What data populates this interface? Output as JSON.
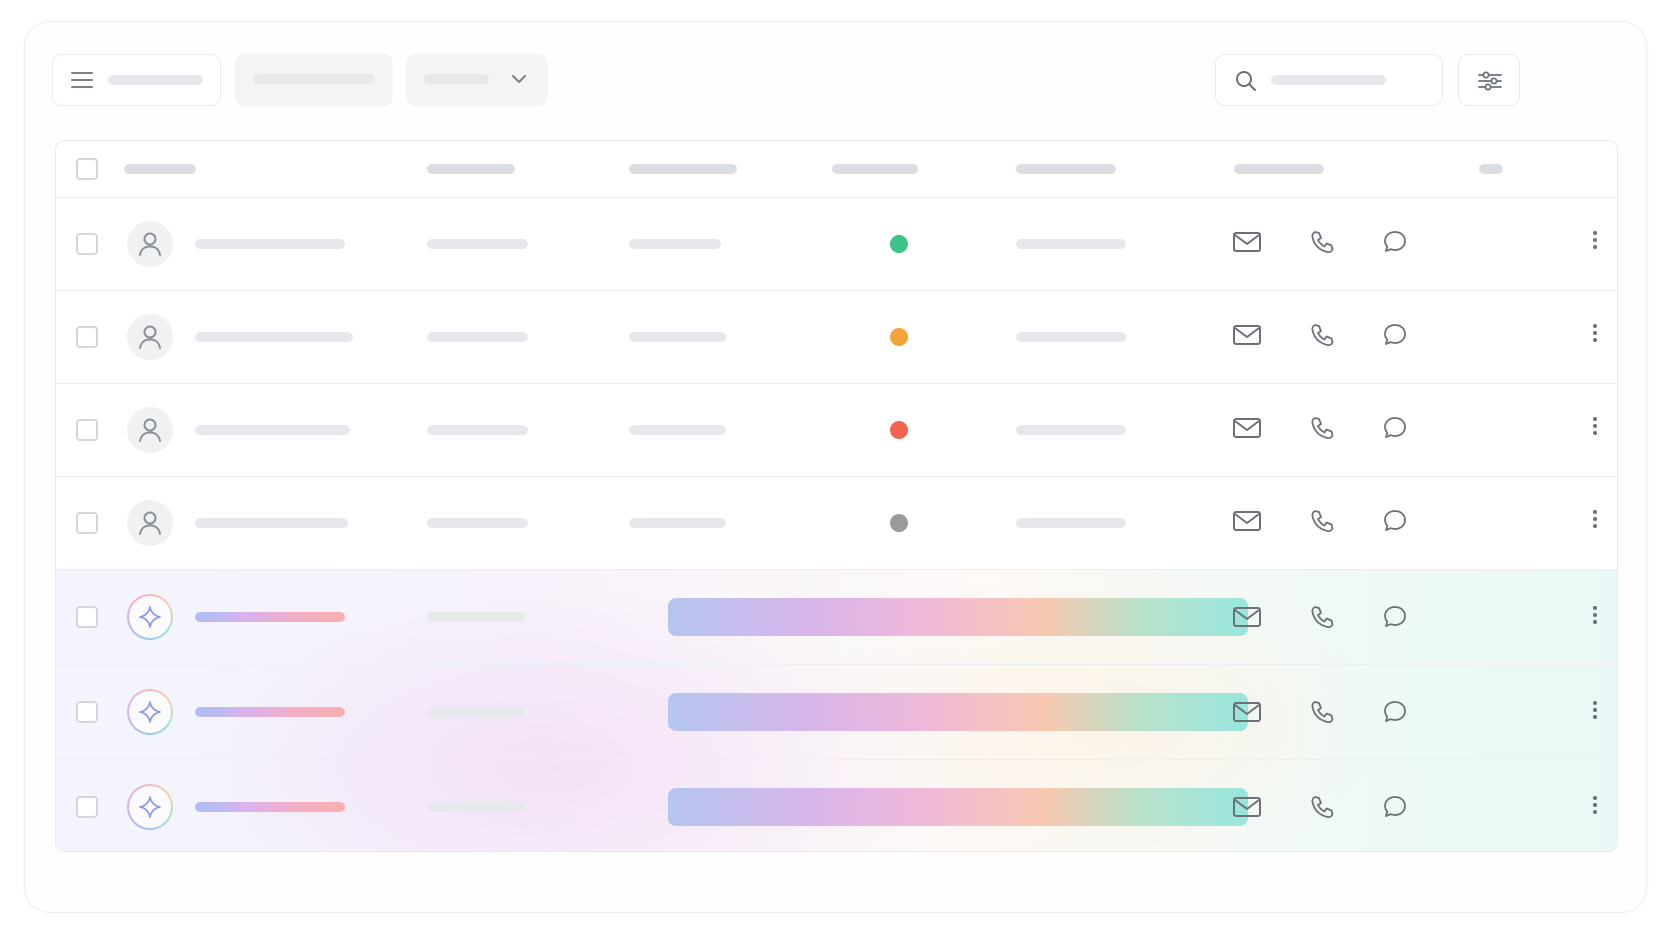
{
  "toolbar": {
    "menu_icon": "hamburger-menu-icon",
    "dropdown_icon": "chevron-down-icon",
    "search_icon": "search-icon",
    "filter_icon": "sliders-icon"
  },
  "table": {
    "row_actions": [
      "mail-icon",
      "phone-icon",
      "chat-bubble-icon",
      "more-vertical-icon"
    ],
    "rows": [
      {
        "kind": "contact",
        "status_color": "#3cc48a",
        "avatar_icon": "user-icon"
      },
      {
        "kind": "contact",
        "status_color": "#f5a23a",
        "avatar_icon": "user-icon"
      },
      {
        "kind": "contact",
        "status_color": "#f2644f",
        "avatar_icon": "user-icon"
      },
      {
        "kind": "contact",
        "status_color": "#9a9a9d",
        "avatar_icon": "user-icon"
      },
      {
        "kind": "ai-generated",
        "avatar_icon": "sparkle-icon"
      },
      {
        "kind": "ai-generated",
        "avatar_icon": "sparkle-icon"
      },
      {
        "kind": "ai-generated",
        "avatar_icon": "sparkle-icon"
      }
    ]
  },
  "colors": {
    "skeleton": "#e6e8ec",
    "border": "#e8eaee",
    "icon": "#6b7079",
    "ai_gradient": [
      "#b5c5f1",
      "#d8b5ea",
      "#f0b9d8",
      "#f8c8b0",
      "#98e6df"
    ]
  }
}
